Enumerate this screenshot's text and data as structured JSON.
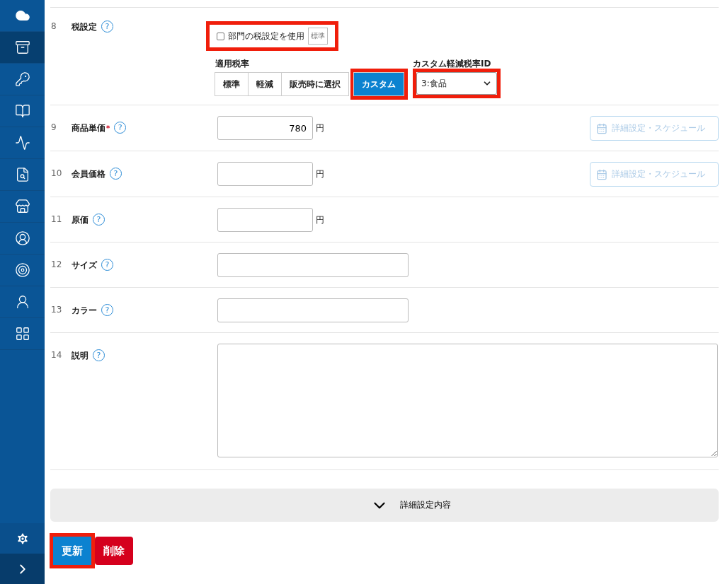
{
  "sidebar": {
    "items": [
      {
        "selected": false
      },
      {
        "selected": true
      },
      {
        "selected": false
      },
      {
        "selected": false
      },
      {
        "selected": false
      },
      {
        "selected": false
      },
      {
        "selected": false
      },
      {
        "selected": false
      },
      {
        "selected": false
      },
      {
        "selected": false
      },
      {
        "selected": false
      }
    ]
  },
  "rows": [
    {
      "kind": "tax",
      "number": "8",
      "label": "税設定",
      "help": "?",
      "dept_checkbox": {
        "label": "部門の税設定を使用",
        "badge": "標準",
        "checked": false,
        "highlighted": true
      },
      "rate_label": "適用税率",
      "rates": [
        {
          "label": "標準",
          "selected": false,
          "highlighted": false
        },
        {
          "label": "軽減",
          "selected": false,
          "highlighted": false
        },
        {
          "label": "販売時に選択",
          "selected": false,
          "highlighted": false
        },
        {
          "label": "カスタム",
          "selected": true,
          "highlighted": true
        }
      ],
      "custom_label": "カスタム軽減税率ID",
      "custom_value": "3:食品",
      "custom_highlighted": true
    },
    {
      "kind": "price",
      "number": "9",
      "label": "商品単価",
      "required_mark": "*",
      "help": "?",
      "value": "780",
      "unit": "円",
      "schedule": "詳細設定・スケジュール"
    },
    {
      "kind": "price",
      "number": "10",
      "label": "会員価格",
      "help": "?",
      "unit": "円",
      "schedule": "詳細設定・スケジュール"
    },
    {
      "kind": "price",
      "number": "11",
      "label": "原価",
      "help": "?",
      "unit": "円"
    },
    {
      "kind": "text",
      "number": "12",
      "label": "サイズ",
      "help": "?"
    },
    {
      "kind": "text",
      "number": "13",
      "label": "カラー",
      "help": "?"
    },
    {
      "kind": "textarea",
      "number": "14",
      "label": "説明",
      "help": "?"
    }
  ],
  "details": {
    "label": "詳細設定内容",
    "expanded": false
  },
  "actions": [
    {
      "label": "更新",
      "kind": "update",
      "highlighted": true
    },
    {
      "label": "削除",
      "kind": "delete",
      "highlighted": false
    }
  ]
}
